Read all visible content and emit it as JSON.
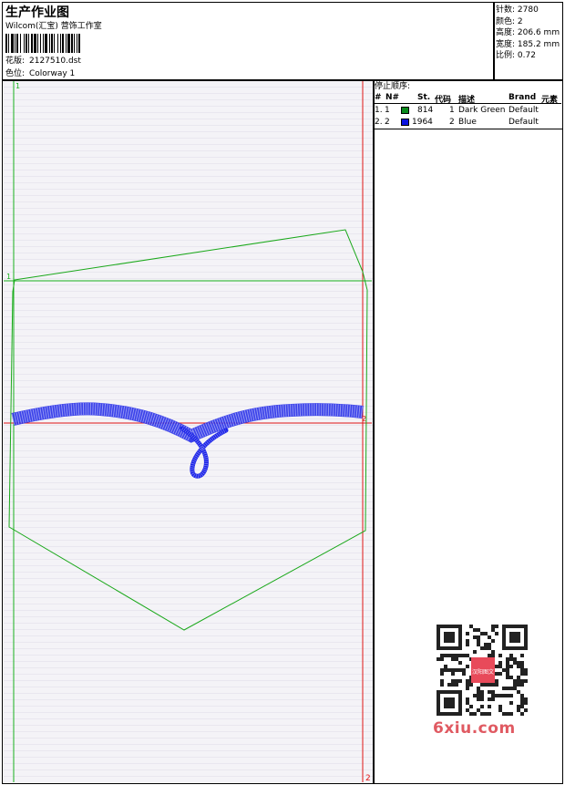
{
  "header": {
    "title": "生产作业图",
    "subtitle": "Wilcom(汇宝) 营饰工作室",
    "design_label": "花版:",
    "design_value": "2127510.dst",
    "colorway_label": "色位:",
    "colorway_value": "Colorway 1"
  },
  "stats": [
    {
      "label": "针数:",
      "value": "2780"
    },
    {
      "label": "颜色:",
      "value": "2"
    },
    {
      "label": "高度:",
      "value": "206.6 mm"
    },
    {
      "label": "宽度:",
      "value": "185.2 mm"
    },
    {
      "label": "比例:",
      "value": "0.72"
    }
  ],
  "stop_sequence": {
    "title": "停止顺序:",
    "columns": [
      "#",
      "N#",
      "St.",
      "代码",
      "描述",
      "Brand",
      "元素"
    ],
    "rows": [
      {
        "idx": "1.",
        "n": "1",
        "stitches": "814",
        "code": "1",
        "desc": "Dark Green",
        "brand": "Default",
        "color": "#0a8a1c"
      },
      {
        "idx": "2.",
        "n": "2",
        "stitches": "1964",
        "code": "2",
        "desc": "Blue",
        "brand": "Default",
        "color": "#0a12e0"
      }
    ]
  },
  "markers": {
    "top_left": "1",
    "bottom_right": "2",
    "row_left": "1",
    "row_right": "2"
  },
  "watermark": {
    "text": "6xiu.com",
    "seal": "汉阳图文"
  },
  "colors": {
    "green": "#19b21e",
    "red": "#e01515",
    "blue": "#1a22e8",
    "outline": "#1aa81a"
  }
}
